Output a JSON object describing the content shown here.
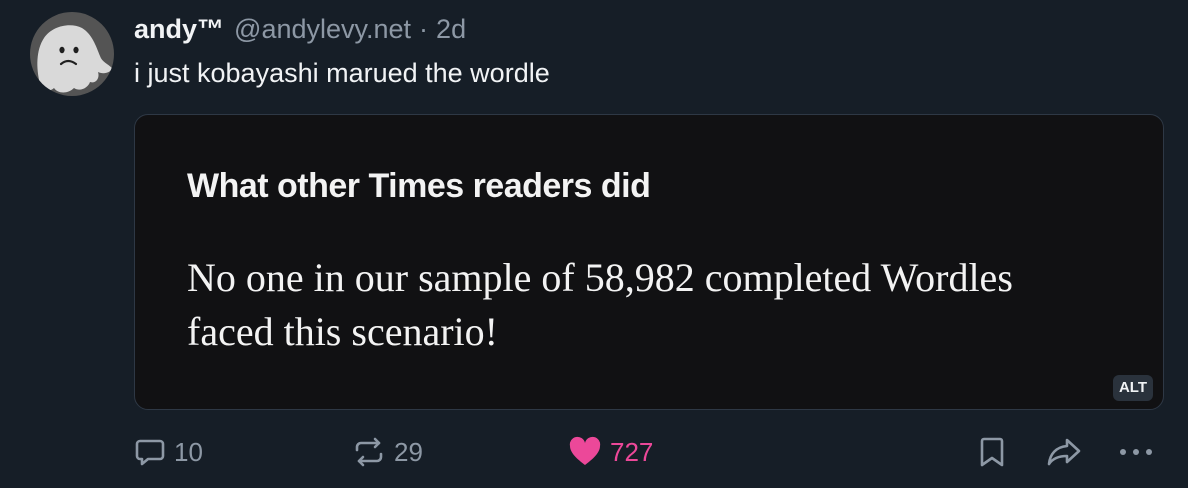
{
  "author": {
    "display_name": "andy™",
    "handle": "@andylevy.net",
    "separator": "·",
    "timestamp": "2d"
  },
  "post": {
    "text": "i just kobayashi marued the wordle"
  },
  "embed": {
    "heading": "What other Times readers did",
    "body": "No one in our sample of 58,982 completed Wordles faced this scenario!",
    "alt_badge": "ALT"
  },
  "actions": {
    "reply_count": "10",
    "repost_count": "29",
    "like_count": "727",
    "like_color": "#ec4899"
  },
  "icons": {
    "reply": "speech-bubble-icon",
    "repost": "repost-arrows-icon",
    "like": "heart-icon",
    "bookmark": "bookmark-icon",
    "share": "share-arrow-icon",
    "more": "ellipsis-icon"
  }
}
